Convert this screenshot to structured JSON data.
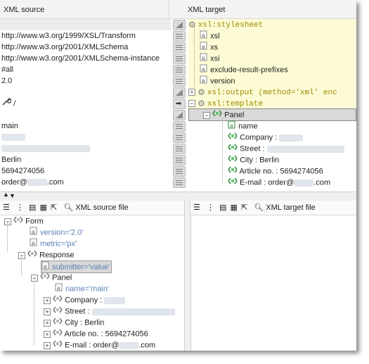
{
  "headers": {
    "source": "XML source",
    "target": "XML target"
  },
  "source_rows": [
    {
      "text": "",
      "selected": true
    },
    {
      "text": "http://www.w3.org/1999/XSL/Transform"
    },
    {
      "text": "http://www.w3.org/2001/XMLSchema"
    },
    {
      "text": "http://www.w3.org/2001/XMLSchema-instance"
    },
    {
      "text": "#all"
    },
    {
      "text": "2.0"
    },
    {
      "text": ""
    },
    {
      "text": "/",
      "prefix_icon": "wrench-icon"
    },
    {
      "text": "main"
    },
    {
      "text": ""
    },
    {
      "text": ""
    },
    {
      "text": "Berlin"
    },
    {
      "text": "5694274056"
    },
    {
      "text": "order@",
      "suffix": ".com"
    }
  ],
  "target_rows": [
    {
      "label": "xsl:stylesheet",
      "kind": "xsl"
    },
    {
      "label": "xsl",
      "kind": "attr"
    },
    {
      "label": "xs",
      "kind": "attr"
    },
    {
      "label": "xsi",
      "kind": "attr"
    },
    {
      "label": "exclude-result-prefixes",
      "kind": "attr"
    },
    {
      "label": "version",
      "kind": "attr"
    },
    {
      "label": "xsl:output (method='xml' enc",
      "kind": "xsl"
    },
    {
      "label": "xsl:template",
      "kind": "xsl"
    },
    {
      "label": "Panel",
      "kind": "elem"
    },
    {
      "label": "name",
      "kind": "attr"
    },
    {
      "label": "Company :",
      "kind": "elem"
    },
    {
      "label": "Street :",
      "kind": "elem"
    },
    {
      "label": "City : Berlin",
      "kind": "elem"
    },
    {
      "label": "Article no. : 5694274056",
      "kind": "elem"
    },
    {
      "label": "E-mail : order@",
      "suffix": ".com",
      "kind": "elem"
    }
  ],
  "bottom_left": {
    "title": "XML source file",
    "tree": [
      {
        "label": "Form",
        "kind": "elem"
      },
      {
        "label": "version='2.0'",
        "kind": "attr"
      },
      {
        "label": "metric='px'",
        "kind": "attr"
      },
      {
        "label": "Response",
        "kind": "elem"
      },
      {
        "label": "submitter='value'",
        "kind": "attr"
      },
      {
        "label": "Panel",
        "kind": "elem"
      },
      {
        "label": "name='main'",
        "kind": "attr"
      },
      {
        "label": "Company :",
        "kind": "elem"
      },
      {
        "label": "Street :",
        "kind": "elem"
      },
      {
        "label": "City : Berlin",
        "kind": "elem"
      },
      {
        "label": "Article no. : 5694274056",
        "kind": "elem"
      },
      {
        "label": "E-mail : order@",
        "suffix": ".com",
        "kind": "elem"
      }
    ]
  },
  "bottom_right": {
    "title": "XML target file"
  },
  "colors": {
    "xsl_keyword": "#9c8a00",
    "attr_text": "#5a7fb5",
    "highlight_row": "#fdfbd5",
    "selected_row": "#d9d9d9"
  }
}
